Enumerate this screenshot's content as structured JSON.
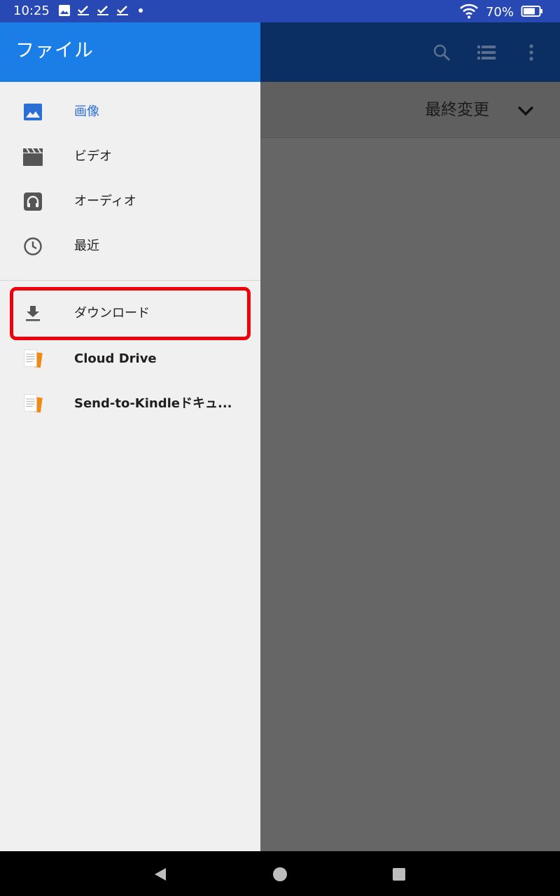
{
  "status_bar": {
    "time": "10:25",
    "left_icons": [
      "image-notification-icon",
      "check-icon",
      "check-icon",
      "check-icon",
      "dot-icon"
    ],
    "wifi_icon": "wifi-icon",
    "battery_percent": "70%",
    "battery_icon": "battery-icon"
  },
  "drawer": {
    "title": "ファイル",
    "items": [
      {
        "label": "画像",
        "icon": "image-icon",
        "selected": true
      },
      {
        "label": "ビデオ",
        "icon": "video-clapper-icon"
      },
      {
        "label": "オーディオ",
        "icon": "headphones-icon"
      },
      {
        "label": "最近",
        "icon": "clock-icon"
      },
      {
        "label": "ダウンロード",
        "icon": "download-icon",
        "highlighted": true
      },
      {
        "label": "Cloud Drive",
        "icon": "document-icon"
      },
      {
        "label": "Send-to-Kindleドキュ...",
        "icon": "document-icon"
      }
    ]
  },
  "toolbar": {
    "actions": [
      "search-icon",
      "list-view-icon",
      "more-vert-icon"
    ]
  },
  "sort": {
    "label": "最終変更",
    "icon": "chevron-down-icon"
  },
  "navigation_bar": {
    "buttons": [
      "back-icon",
      "home-icon",
      "recents-icon"
    ]
  },
  "colors": {
    "status_bar": "#2849b4",
    "drawer_header": "#1b7de6",
    "drawer_background": "#f0f0f0",
    "selected_text": "#2b6fd6",
    "highlight_border": "#f0000a",
    "scrim": "#666666"
  }
}
